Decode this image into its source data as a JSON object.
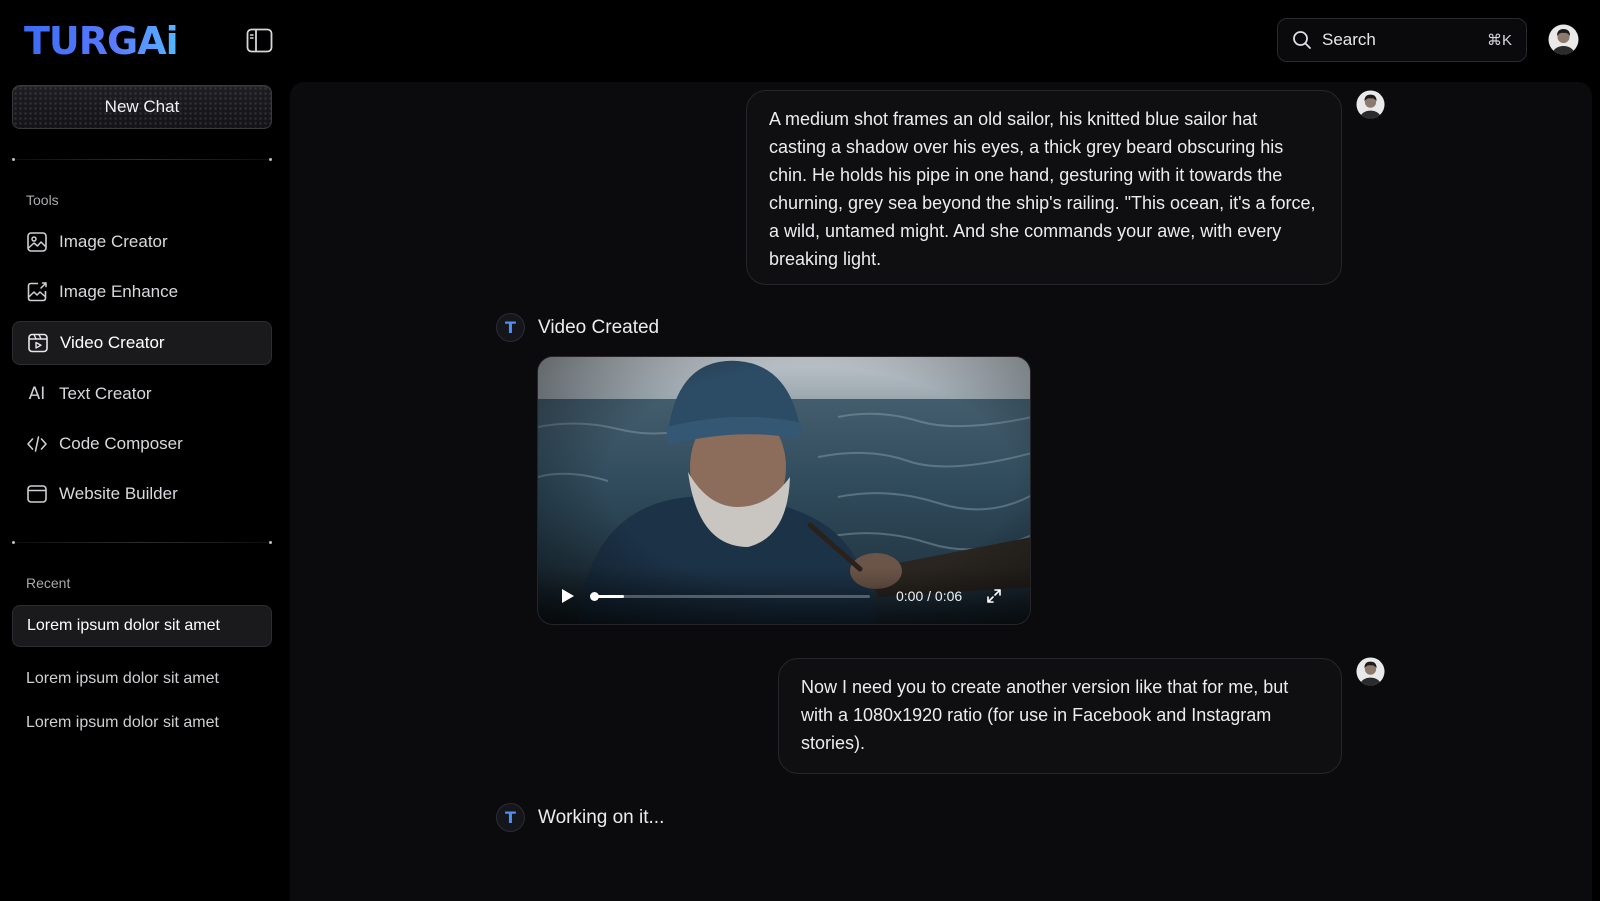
{
  "brand": {
    "logo_text": "TURGAi",
    "accent": "#4f7cf7"
  },
  "header": {
    "search": {
      "label": "Search",
      "shortcut": "⌘K"
    }
  },
  "sidebar": {
    "new_chat_label": "New Chat",
    "tools_label": "Tools",
    "tools": [
      {
        "label": "Image Creator",
        "icon": "image-icon"
      },
      {
        "label": "Image Enhance",
        "icon": "image-enhance-icon"
      },
      {
        "label": "Video Creator",
        "icon": "video-icon",
        "active": true
      },
      {
        "label": "Text Creator",
        "icon": "ai-text-icon",
        "glyph": "AI"
      },
      {
        "label": "Code Composer",
        "icon": "code-icon"
      },
      {
        "label": "Website Builder",
        "icon": "browser-window-icon"
      }
    ],
    "recent_label": "Recent",
    "recent": [
      {
        "label": "Lorem ipsum dolor sit amet",
        "active": true
      },
      {
        "label": "Lorem ipsum dolor sit amet"
      },
      {
        "label": "Lorem ipsum dolor sit amet"
      }
    ]
  },
  "chat": {
    "messages": [
      {
        "role": "user",
        "text": "A medium shot frames an old sailor, his knitted blue sailor hat casting a shadow over his eyes, a thick grey beard obscuring his chin. He holds his pipe in one hand, gesturing with it towards the churning, grey sea beyond the ship's railing. \"This ocean, it's a force, a wild, untamed might. And she commands your awe, with every breaking light."
      },
      {
        "role": "assistant",
        "badge": "T",
        "title": "Video Created",
        "video": {
          "time": "0:00 / 0:06",
          "progress": 0
        }
      },
      {
        "role": "user",
        "text": "Now I need you to create another version like that for me, but with a 1080x1920 ratio (for use in Facebook and Instagram stories)."
      },
      {
        "role": "assistant",
        "badge": "T",
        "title": "Working on it..."
      }
    ]
  }
}
